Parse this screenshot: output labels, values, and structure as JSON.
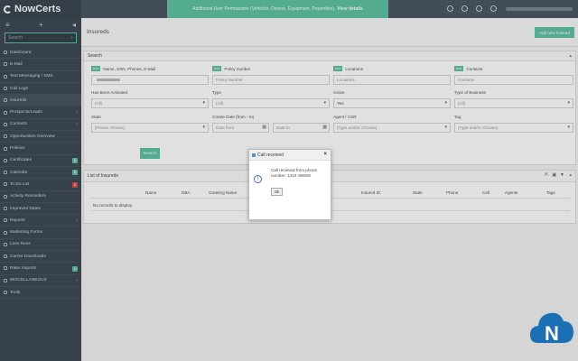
{
  "app": {
    "name": "NowCerts"
  },
  "banner": {
    "text": "Additional User Permissions (Vehicles, Drivers, Equipment, Properties).",
    "link": "View details"
  },
  "sidebar": {
    "search_placeholder": "Search",
    "items": [
      {
        "label": "Dashboard",
        "icon": "home-icon"
      },
      {
        "label": "E-Mail",
        "icon": "email-icon"
      },
      {
        "label": "Text Messaging / SMS",
        "icon": "sms-icon"
      },
      {
        "label": "Call Logs",
        "icon": "phone-icon"
      },
      {
        "label": "Insureds",
        "icon": "insureds-icon"
      },
      {
        "label": "Prospects/Leads",
        "icon": "prospects-icon",
        "arrow": "‹"
      },
      {
        "label": "Contacts",
        "icon": "contacts-icon",
        "arrow": "‹"
      },
      {
        "label": "Opportunities Overview",
        "icon": "opportunities-icon"
      },
      {
        "label": "Policies",
        "icon": "policies-icon"
      },
      {
        "label": "Certificates",
        "icon": "certificates-icon",
        "badge": "6",
        "badge_color": "#5fc4a4"
      },
      {
        "label": "Calendar",
        "icon": "calendar-icon",
        "badge": "0",
        "badge_color": "#5fc4a4"
      },
      {
        "label": "To Do List",
        "icon": "todo-icon",
        "badge": "0",
        "badge_color": "#e0504a"
      },
      {
        "label": "Activity Reminders",
        "icon": "reminder-icon"
      },
      {
        "label": "Improved Dates",
        "icon": "dates-icon"
      },
      {
        "label": "Reports",
        "icon": "reports-icon",
        "arrow": "‹"
      },
      {
        "label": "Marketing Forms",
        "icon": "marketing-icon"
      },
      {
        "label": "Loss Runs",
        "icon": "lossruns-icon"
      },
      {
        "label": "Carrier Downloads",
        "icon": "download-icon"
      },
      {
        "label": "Rater Imports",
        "icon": "import-icon",
        "badge": "1",
        "badge_color": "#5fc4a4"
      },
      {
        "label": "MISCELLANEOUS",
        "icon": "misc-icon",
        "arrow": "‹"
      },
      {
        "label": "Tools",
        "icon": "tools-icon"
      }
    ]
  },
  "page": {
    "title": "Insureds",
    "add_button": "Add new Insured"
  },
  "search": {
    "title": "Search",
    "fields": {
      "name_label": "Name, SSN, Phones, E-Mail",
      "name_tag": "Info",
      "policy_label": "Policy number",
      "policy_tag": "Info",
      "policy_placeholder": "Policy Number",
      "locations_label": "Locations",
      "locations_tag": "Info",
      "locations_placeholder": "Locations",
      "contacts_label": "Contacts",
      "contacts_tag": "Info",
      "contacts_placeholder": "Contacts",
      "has_label": "Has Been Activated",
      "has_value": "(All)",
      "type_label": "Type",
      "type_value": "(All)",
      "active_label": "Active",
      "active_value": "Yes",
      "business_label": "Type of Business",
      "business_value": "(All)",
      "state_label": "State",
      "state_value": "[Please choose]",
      "date_label": "Create Date (from - to)",
      "date_from": "Date from",
      "date_to": "Date to",
      "agent_label": "Agent / CSR",
      "agent_value": "(Type and/or Choose)",
      "tag_label": "Tag",
      "tag_value": "(Type and/or Choose)"
    },
    "button": "Search"
  },
  "list": {
    "title": "List of Insureds",
    "columns": [
      "Name",
      "DBA",
      "Greeting Name",
      "Insured ID",
      "State",
      "Phone",
      "Cell",
      "Agents",
      "Tags"
    ],
    "empty": "No records to display."
  },
  "modal": {
    "title": "Call received",
    "message": "Call received from phone number: 1310",
    "ok": "Ok"
  },
  "colors": {
    "accent": "#5fc4a4",
    "sidebar": "#3f4b56",
    "topbar": "#4c5864"
  }
}
